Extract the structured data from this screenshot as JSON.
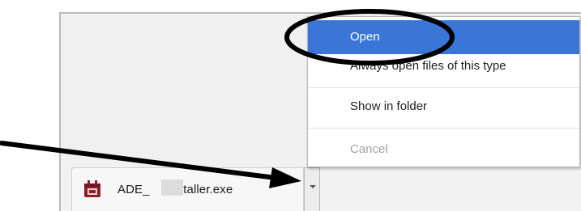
{
  "download_shelf": {
    "file_name": "ADE_     Installer.exe"
  },
  "context_menu": {
    "items": [
      {
        "label": "Open",
        "highlighted": true
      },
      {
        "label": "Always open files of this type"
      },
      {
        "label": "Show in folder"
      },
      {
        "label": "Cancel",
        "disabled": true
      }
    ]
  },
  "colors": {
    "highlight": "#3a76d8",
    "annotation": "#000000"
  }
}
